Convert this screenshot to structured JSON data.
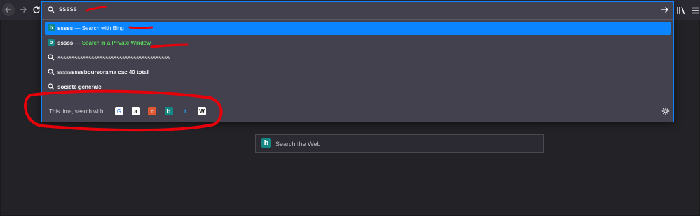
{
  "urlbar": {
    "typed_text": "sssss"
  },
  "results": [
    {
      "bold": "sssss",
      "dash": " — ",
      "action": "Search with Bing"
    },
    {
      "bold": "sssss",
      "dash": " — ",
      "action": "Search in a Private Window"
    },
    {
      "plain": "ssssssssssssssssssssssssssssssssssssssss"
    },
    {
      "plain": "sssss",
      "bold": "ssssboursorama cac 40 total"
    },
    {
      "bold": "société générale"
    }
  ],
  "oneoffs": {
    "label": "This time, search with:",
    "engines": [
      {
        "name": "google-engine-icon",
        "glyph": "G",
        "bg": "#ffffff",
        "fg": "#4285f4"
      },
      {
        "name": "amazon-engine-icon",
        "glyph": "a",
        "bg": "#ffffff",
        "fg": "#222222"
      },
      {
        "name": "duckduckgo-engine-icon",
        "glyph": "d",
        "bg": "#de5833",
        "fg": "#ffffff"
      },
      {
        "name": "bing-engine-icon",
        "glyph": "b",
        "bg": "#148684",
        "fg": "#ffffff"
      },
      {
        "name": "twitter-engine-icon",
        "glyph": "t",
        "bg": "#42414d",
        "fg": "#1da1f2"
      },
      {
        "name": "wikipedia-engine-icon",
        "glyph": "W",
        "bg": "#ffffff",
        "fg": "#000000"
      }
    ]
  },
  "page": {
    "search_placeholder": "Search the Web"
  },
  "colors": {
    "accent": "#0a84ff",
    "private_green": "#65ff62",
    "annotation_red": "#e8000b"
  }
}
